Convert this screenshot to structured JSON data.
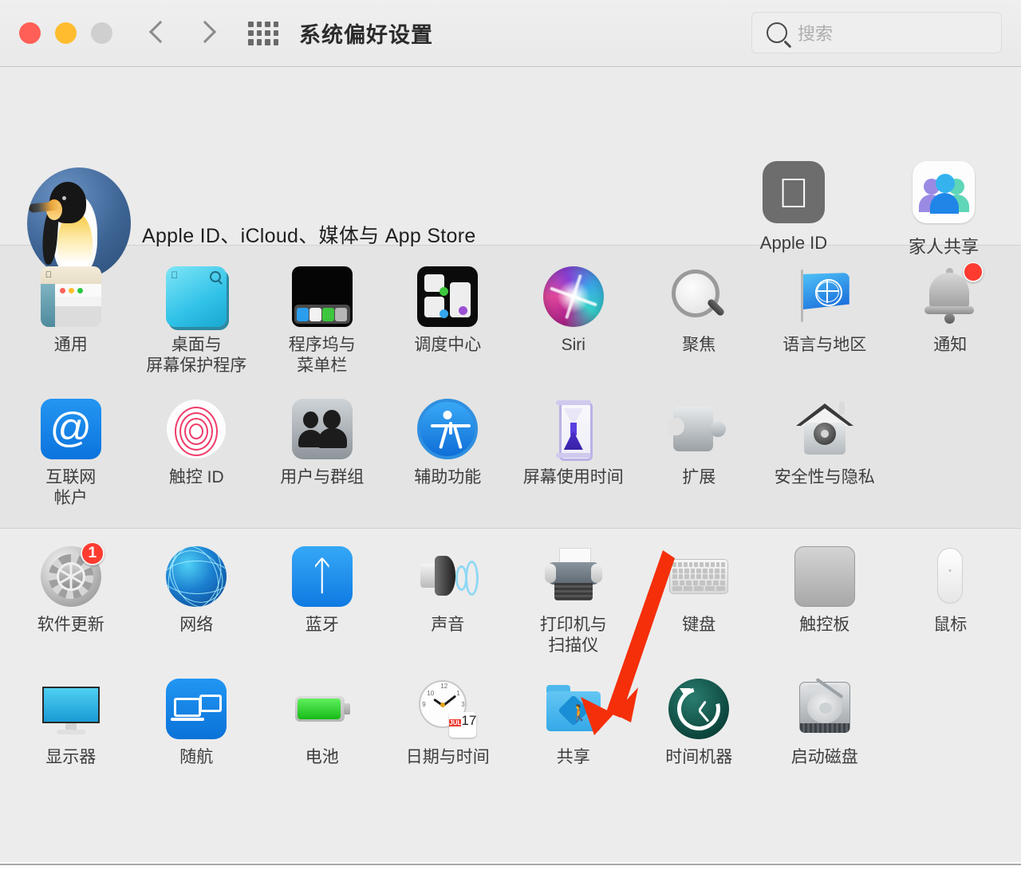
{
  "window": {
    "title": "系统偏好设置",
    "traffic_lights": [
      "close",
      "minimize",
      "zoom"
    ],
    "nav": {
      "back": "‹",
      "forward": "›"
    },
    "show_all_icon": "grid-icon",
    "search": {
      "placeholder": "搜索",
      "value": "",
      "icon": "search-icon"
    }
  },
  "account": {
    "avatar_icon": "penguin-avatar",
    "name_redacted": [
      "block-1",
      "block-2",
      "block-3"
    ],
    "subtitle": "Apple ID、iCloud、媒体与 App Store",
    "tiles": [
      {
        "label": "Apple ID",
        "icon": "apple-logo-icon"
      },
      {
        "label": "家人共享",
        "icon": "family-sharing-icon"
      }
    ]
  },
  "sections": [
    {
      "name": "personal",
      "items": [
        {
          "label": "通用",
          "icon": "general-icon",
          "badge": null
        },
        {
          "label": "桌面与\n屏幕保护程序",
          "icon": "desktop-screensaver-icon",
          "badge": null
        },
        {
          "label": "程序坞与\n菜单栏",
          "icon": "dock-menubar-icon",
          "badge": null
        },
        {
          "label": "调度中心",
          "icon": "mission-control-icon",
          "badge": null
        },
        {
          "label": "Siri",
          "icon": "siri-icon",
          "badge": null
        },
        {
          "label": "聚焦",
          "icon": "spotlight-icon",
          "badge": null
        },
        {
          "label": "语言与地区",
          "icon": "language-region-icon",
          "badge": null
        },
        {
          "label": "通知",
          "icon": "notifications-icon",
          "badge": ""
        },
        {
          "label": "互联网\n帐户",
          "icon": "internet-accounts-icon",
          "badge": null
        },
        {
          "label": "触控 ID",
          "icon": "touch-id-icon",
          "badge": null
        },
        {
          "label": "用户与群组",
          "icon": "users-groups-icon",
          "badge": null
        },
        {
          "label": "辅助功能",
          "icon": "accessibility-icon",
          "badge": null
        },
        {
          "label": "屏幕使用时间",
          "icon": "screen-time-icon",
          "badge": null
        },
        {
          "label": "扩展",
          "icon": "extensions-icon",
          "badge": null
        },
        {
          "label": "安全性与隐私",
          "icon": "security-privacy-icon",
          "badge": null
        }
      ]
    },
    {
      "name": "hardware",
      "items": [
        {
          "label": "软件更新",
          "icon": "software-update-icon",
          "badge": "1"
        },
        {
          "label": "网络",
          "icon": "network-icon",
          "badge": null
        },
        {
          "label": "蓝牙",
          "icon": "bluetooth-icon",
          "badge": null
        },
        {
          "label": "声音",
          "icon": "sound-icon",
          "badge": null
        },
        {
          "label": "打印机与\n扫描仪",
          "icon": "printers-scanners-icon",
          "badge": null
        },
        {
          "label": "键盘",
          "icon": "keyboard-icon",
          "badge": null
        },
        {
          "label": "触控板",
          "icon": "trackpad-icon",
          "badge": null
        },
        {
          "label": "鼠标",
          "icon": "mouse-icon",
          "badge": null
        },
        {
          "label": "显示器",
          "icon": "displays-icon",
          "badge": null
        },
        {
          "label": "随航",
          "icon": "sidecar-icon",
          "badge": null
        },
        {
          "label": "电池",
          "icon": "battery-icon",
          "badge": null
        },
        {
          "label": "日期与时间",
          "icon": "date-time-icon",
          "badge": null
        },
        {
          "label": "共享",
          "icon": "sharing-icon",
          "badge": null
        },
        {
          "label": "时间机器",
          "icon": "time-machine-icon",
          "badge": null
        },
        {
          "label": "启动磁盘",
          "icon": "startup-disk-icon",
          "badge": null
        }
      ]
    }
  ],
  "date_time_icon": {
    "month": "JUL",
    "day": "17"
  },
  "annotation": {
    "type": "arrow",
    "color": "#f52f0a",
    "points_to": "共享"
  },
  "colors": {
    "accent_red": "#ff3b30",
    "annotation_red": "#f52f0a",
    "window_bg": "#ececec",
    "section_mid_bg": "#e4e4e4",
    "title_text": "#2a2a2a",
    "label_text": "#3d3d3d"
  }
}
